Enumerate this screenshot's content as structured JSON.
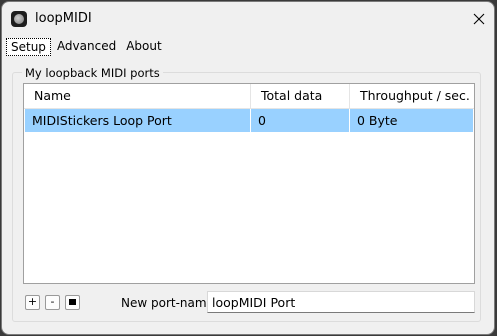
{
  "window": {
    "title": "loopMIDI",
    "app_icon": "loopmidi-app-icon",
    "close_icon": "close-icon"
  },
  "tabs": [
    {
      "label": "Setup",
      "active": true
    },
    {
      "label": "Advanced",
      "active": false
    },
    {
      "label": "About",
      "active": false
    }
  ],
  "ports_group": {
    "label": "My loopback MIDI ports",
    "columns": [
      "Name",
      "Total data",
      "Throughput / sec."
    ],
    "rows": [
      {
        "name": "MIDIStickers Loop Port",
        "total_data": "0",
        "throughput": "0 Byte",
        "selected": true
      }
    ]
  },
  "controls": {
    "add_label": "+",
    "remove_label": "-",
    "stop_icon": "stop-square-icon",
    "new_port_label": "New port-name:",
    "new_port_value": "loopMIDI Port"
  },
  "colors": {
    "selection": "#99d1ff",
    "window_bg": "#f0f0f0"
  }
}
